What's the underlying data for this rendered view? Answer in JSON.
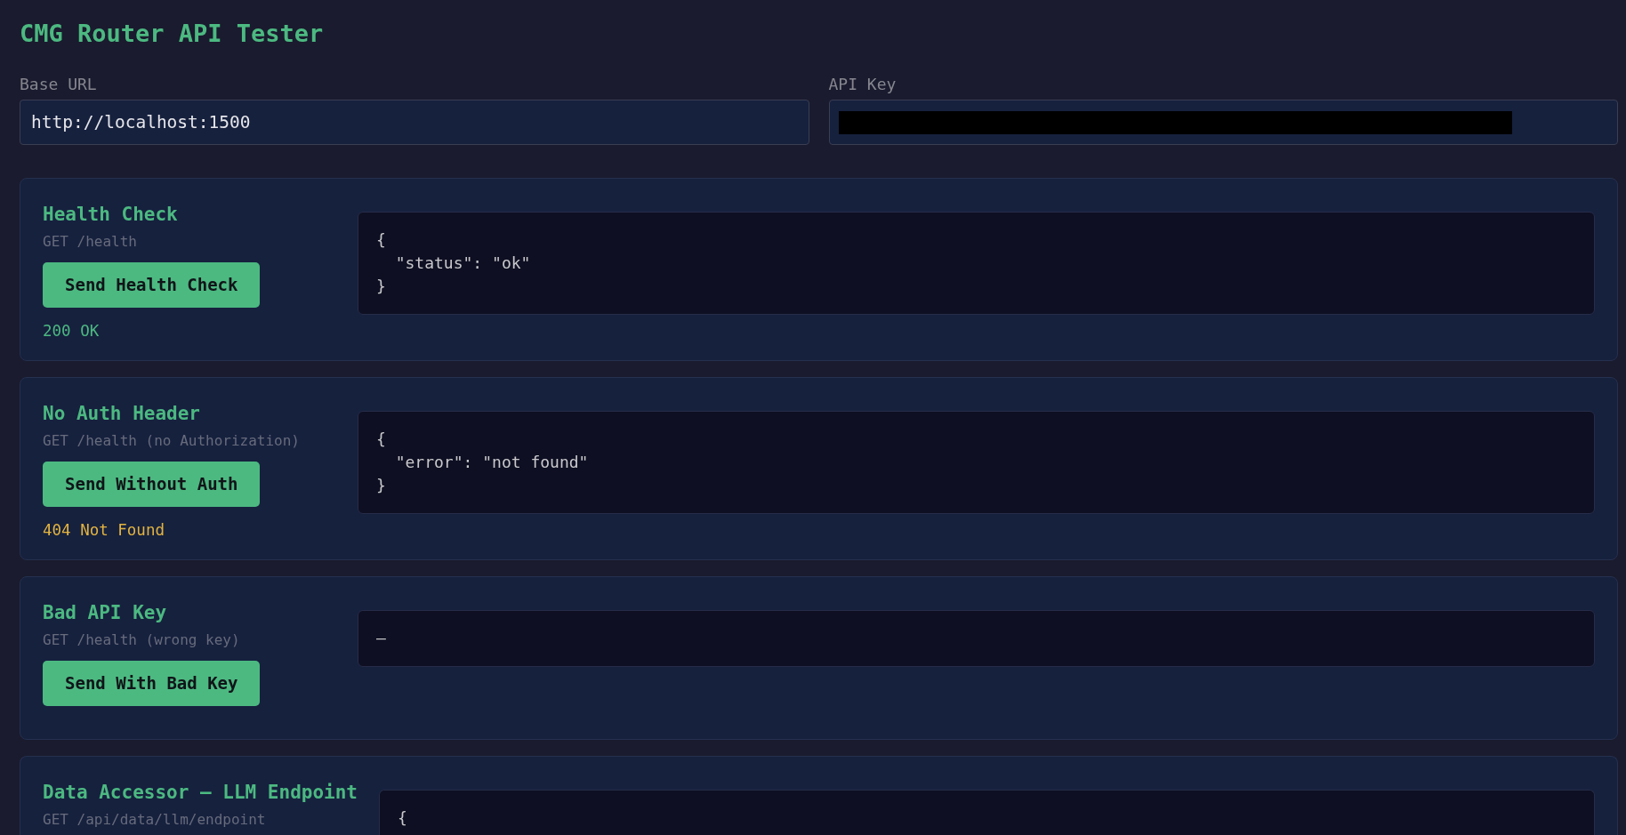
{
  "title": "CMG Router API Tester",
  "fields": [
    {
      "label": "Base URL",
      "value": "http://localhost:1500"
    },
    {
      "label": "API Key",
      "redacted": true
    }
  ],
  "tests": [
    {
      "title": "Health Check",
      "request": "GET /health",
      "button": "Send Health Check",
      "status": {
        "text": "200 OK",
        "color": "#4cb981"
      },
      "response": "{\n  \"status\": \"ok\"\n}"
    },
    {
      "title": "No Auth Header",
      "request": "GET /health (no Authorization)",
      "button": "Send Without Auth",
      "status": {
        "text": "404 Not Found",
        "color": "#e2b340"
      },
      "response": "{\n  \"error\": \"not found\"\n}"
    },
    {
      "title": "Bad API Key",
      "request": "GET /health (wrong key)",
      "button": "Send With Bad Key",
      "response": "—"
    },
    {
      "title": "Data Accessor — LLM Endpoint",
      "request": "GET /api/data/llm/endpoint",
      "response": "{"
    }
  ]
}
